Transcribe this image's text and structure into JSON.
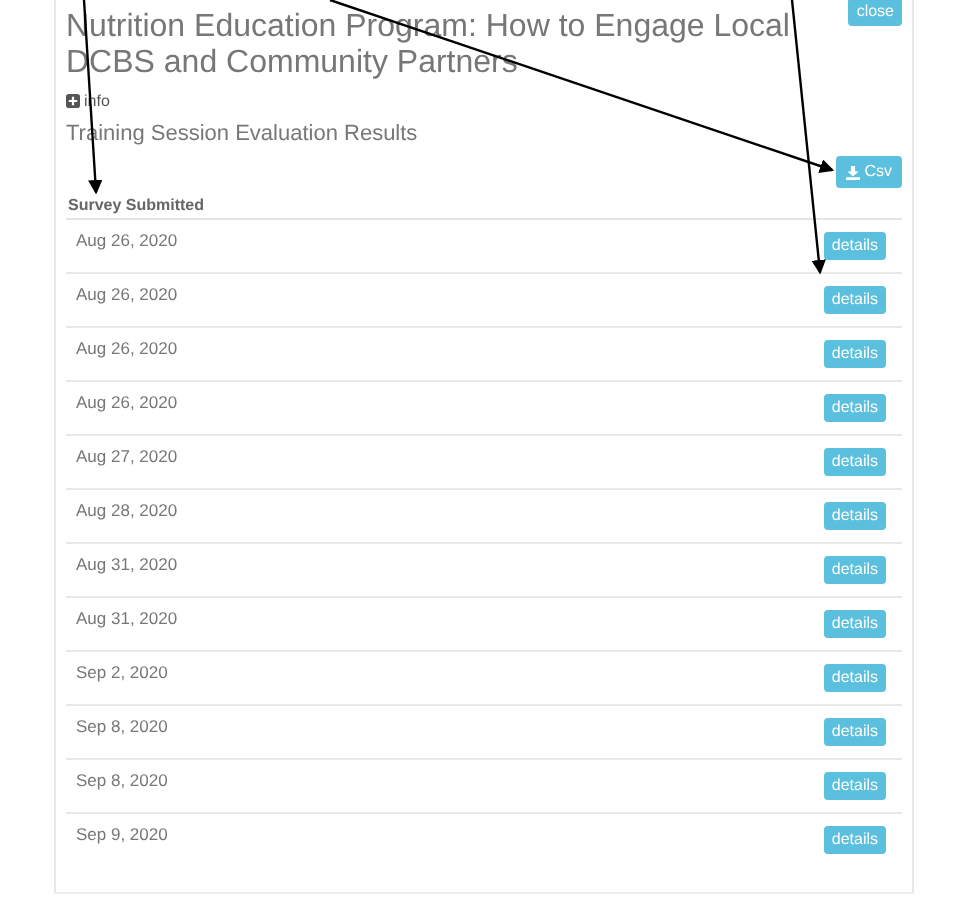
{
  "title": "Nutrition Education Program: How to Engage Local DCBS and Community Partners",
  "close_button": "close",
  "info_link": "info",
  "subtitle": "Training Session Evaluation Results",
  "csv_button": "Csv",
  "table": {
    "columns": [
      "Survey Submitted"
    ],
    "rows": [
      {
        "date": "Aug 26, 2020",
        "action": "details"
      },
      {
        "date": "Aug 26, 2020",
        "action": "details"
      },
      {
        "date": "Aug 26, 2020",
        "action": "details"
      },
      {
        "date": "Aug 26, 2020",
        "action": "details"
      },
      {
        "date": "Aug 27, 2020",
        "action": "details"
      },
      {
        "date": "Aug 28, 2020",
        "action": "details"
      },
      {
        "date": "Aug 31, 2020",
        "action": "details"
      },
      {
        "date": "Aug 31, 2020",
        "action": "details"
      },
      {
        "date": "Sep 2, 2020",
        "action": "details"
      },
      {
        "date": "Sep 8, 2020",
        "action": "details"
      },
      {
        "date": "Sep 8, 2020",
        "action": "details"
      },
      {
        "date": "Sep 9, 2020",
        "action": "details"
      }
    ]
  }
}
